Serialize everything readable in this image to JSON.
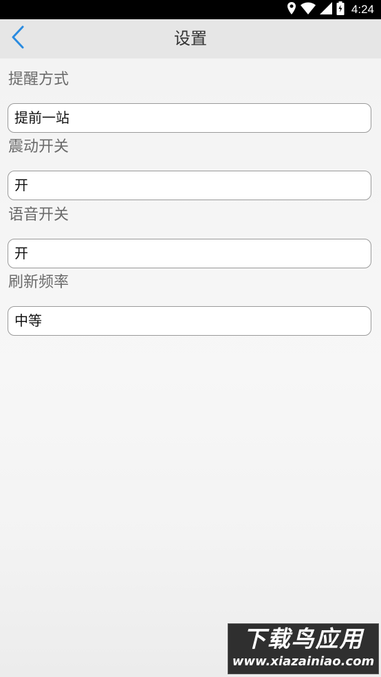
{
  "status_bar": {
    "time": "4:24"
  },
  "header": {
    "title": "设置"
  },
  "settings": [
    {
      "label": "提醒方式",
      "value": "提前一站"
    },
    {
      "label": "震动开关",
      "value": "开"
    },
    {
      "label": "语音开关",
      "value": "开"
    },
    {
      "label": "刷新频率",
      "value": "中等"
    }
  ],
  "watermark": {
    "title": "下载鸟应用",
    "url": "www.xiazainiao.com"
  },
  "colors": {
    "back_arrow": "#2a8be0",
    "header_bg": "#e6e6e6",
    "status_bar_bg": "#000000"
  }
}
